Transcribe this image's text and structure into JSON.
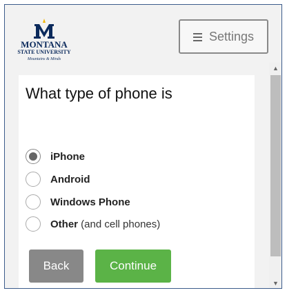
{
  "logo": {
    "line1": "MONTANA",
    "line2": "STATE UNIVERSITY",
    "line3": "Mountains & Minds",
    "colors": {
      "navy": "#0b2a5c",
      "gold": "#f2b500"
    }
  },
  "header": {
    "settings_label": "Settings",
    "settings_icon": "menu-icon"
  },
  "question": {
    "text": "What type of phone is",
    "selected": "iPhone",
    "options": [
      {
        "label": "iPhone",
        "note": "",
        "checked": true
      },
      {
        "label": "Android",
        "note": "",
        "checked": false
      },
      {
        "label": "Windows Phone",
        "note": "",
        "checked": false
      },
      {
        "label": "Other",
        "note": " (and cell phones)",
        "checked": false
      }
    ]
  },
  "buttons": {
    "back_label": "Back",
    "continue_label": "Continue",
    "colors": {
      "back": "#888888",
      "continue": "#5bb347"
    }
  },
  "scrollbar": {
    "up_icon": "scroll-up-arrow-icon",
    "down_icon": "scroll-down-arrow-icon"
  }
}
